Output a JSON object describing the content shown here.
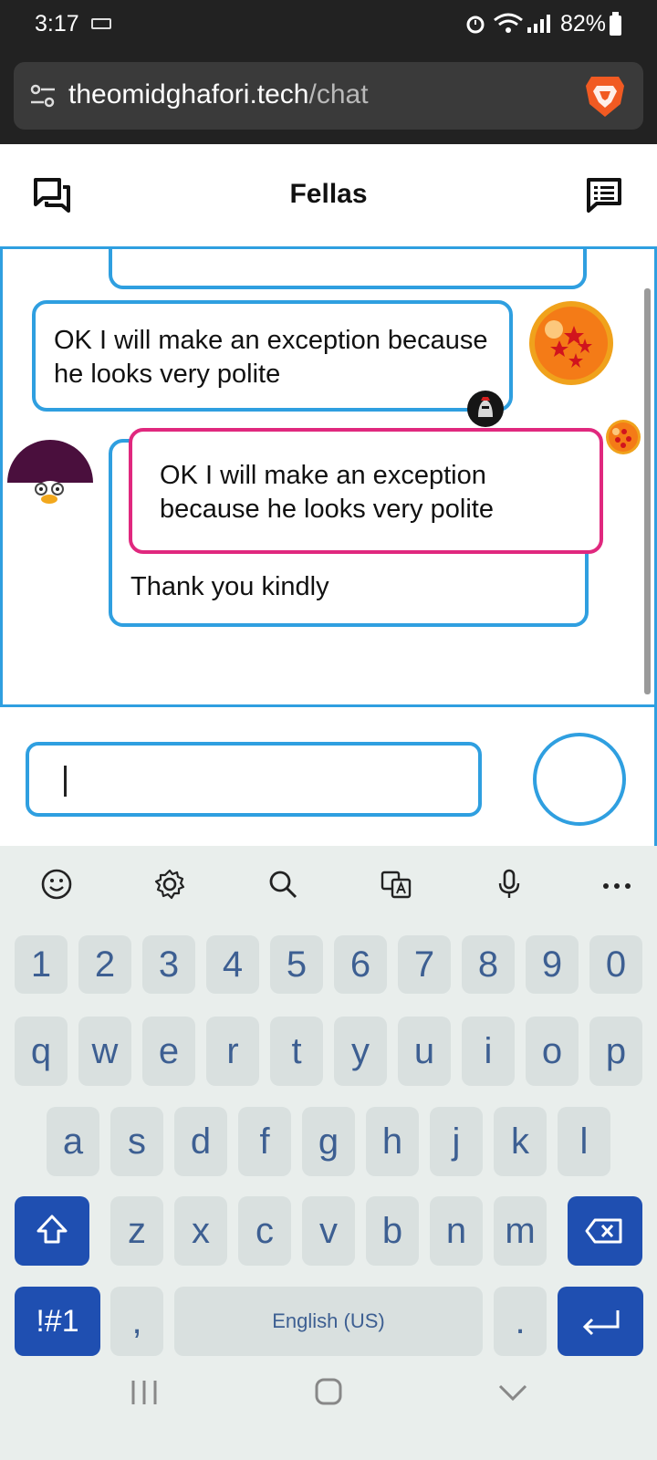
{
  "status_bar": {
    "time": "3:17",
    "battery": "82%"
  },
  "browser": {
    "url_host": "theomidghafori.tech",
    "url_path": "/chat"
  },
  "header": {
    "title": "Fellas"
  },
  "messages": [
    {
      "text": "OK I will make an exception because he looks very polite"
    },
    {
      "quote": "OK I will make an exception because he looks very polite",
      "text": "Thank you kindly"
    }
  ],
  "composer": {
    "value": ""
  },
  "keyboard": {
    "number_row": [
      "1",
      "2",
      "3",
      "4",
      "5",
      "6",
      "7",
      "8",
      "9",
      "0"
    ],
    "row1": [
      "q",
      "w",
      "e",
      "r",
      "t",
      "y",
      "u",
      "i",
      "o",
      "p"
    ],
    "row2": [
      "a",
      "s",
      "d",
      "f",
      "g",
      "h",
      "j",
      "k",
      "l"
    ],
    "row3": [
      "z",
      "x",
      "c",
      "v",
      "b",
      "n",
      "m"
    ],
    "symbols_label": "!#1",
    "comma": ",",
    "space_label": "English (US)",
    "period": "."
  },
  "colors": {
    "accent": "#2f9fe0",
    "quote_border": "#e0287e",
    "key_blue": "#1f4fb1"
  }
}
